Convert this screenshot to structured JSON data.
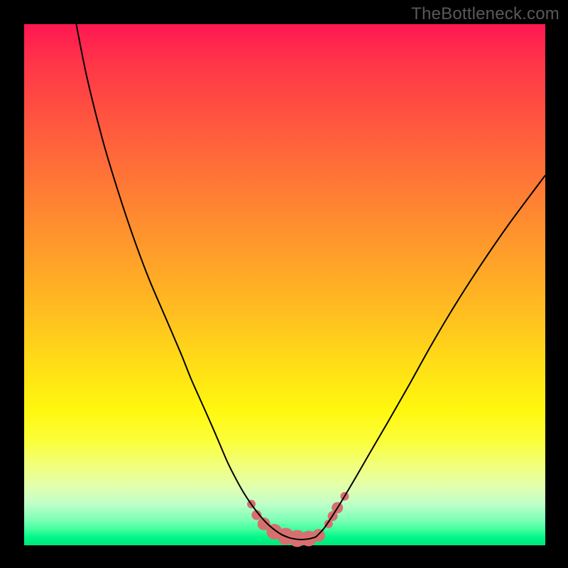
{
  "watermark": "TheBottleneck.com",
  "colors": {
    "background": "#000000",
    "curve_stroke": "#000000",
    "marker_fill": "#d6706f",
    "gradient": [
      "#ff1752",
      "#ff3748",
      "#ff5a3e",
      "#ff7c34",
      "#ff9e2a",
      "#ffc020",
      "#ffe016",
      "#fff70f",
      "#fbff3a",
      "#f0ff80",
      "#e0ffb0",
      "#c0ffc8",
      "#80ffb8",
      "#40ff9d",
      "#00f789",
      "#00e77a"
    ]
  },
  "chart_data": {
    "type": "line",
    "title": "",
    "xlabel": "",
    "ylabel": "",
    "xlim": [
      0,
      100
    ],
    "ylim": [
      0,
      100
    ],
    "series": [
      {
        "name": "left-curve",
        "x": [
          10,
          12,
          15,
          18,
          21,
          24,
          27,
          30,
          32,
          34,
          36,
          37.5,
          39,
          40.5,
          42,
          43.5,
          45,
          46.5,
          48,
          49.5,
          51
        ],
        "y": [
          100,
          90,
          78,
          68,
          59,
          51,
          44,
          37,
          32,
          27.5,
          23,
          19.5,
          16,
          13,
          10.3,
          8,
          6,
          4.3,
          3,
          2,
          1.4
        ]
      },
      {
        "name": "valley-floor",
        "x": [
          51,
          52,
          53,
          54,
          55,
          56
        ],
        "y": [
          1.4,
          1.2,
          1.1,
          1.15,
          1.3,
          1.6
        ]
      },
      {
        "name": "right-curve",
        "x": [
          56,
          57.5,
          59,
          61,
          63.5,
          66.5,
          70,
          74,
          78,
          82.5,
          87.5,
          93,
          100
        ],
        "y": [
          1.6,
          3.2,
          5.4,
          8.6,
          12.8,
          18,
          24,
          31,
          38.2,
          45.8,
          53.6,
          61.6,
          71
        ]
      }
    ],
    "markers": [
      {
        "x": 43.6,
        "y": 7.9,
        "r": 6
      },
      {
        "x": 44.6,
        "y": 5.8,
        "r": 7
      },
      {
        "x": 46.0,
        "y": 4.1,
        "r": 9
      },
      {
        "x": 48.0,
        "y": 2.6,
        "r": 11
      },
      {
        "x": 50.2,
        "y": 1.7,
        "r": 12
      },
      {
        "x": 52.4,
        "y": 1.3,
        "r": 12
      },
      {
        "x": 54.6,
        "y": 1.3,
        "r": 11
      },
      {
        "x": 56.5,
        "y": 1.9,
        "r": 9
      },
      {
        "x": 58.4,
        "y": 4.1,
        "r": 6
      },
      {
        "x": 59.2,
        "y": 5.6,
        "r": 7
      },
      {
        "x": 60.1,
        "y": 7.2,
        "r": 8
      },
      {
        "x": 61.5,
        "y": 9.4,
        "r": 6
      }
    ]
  }
}
